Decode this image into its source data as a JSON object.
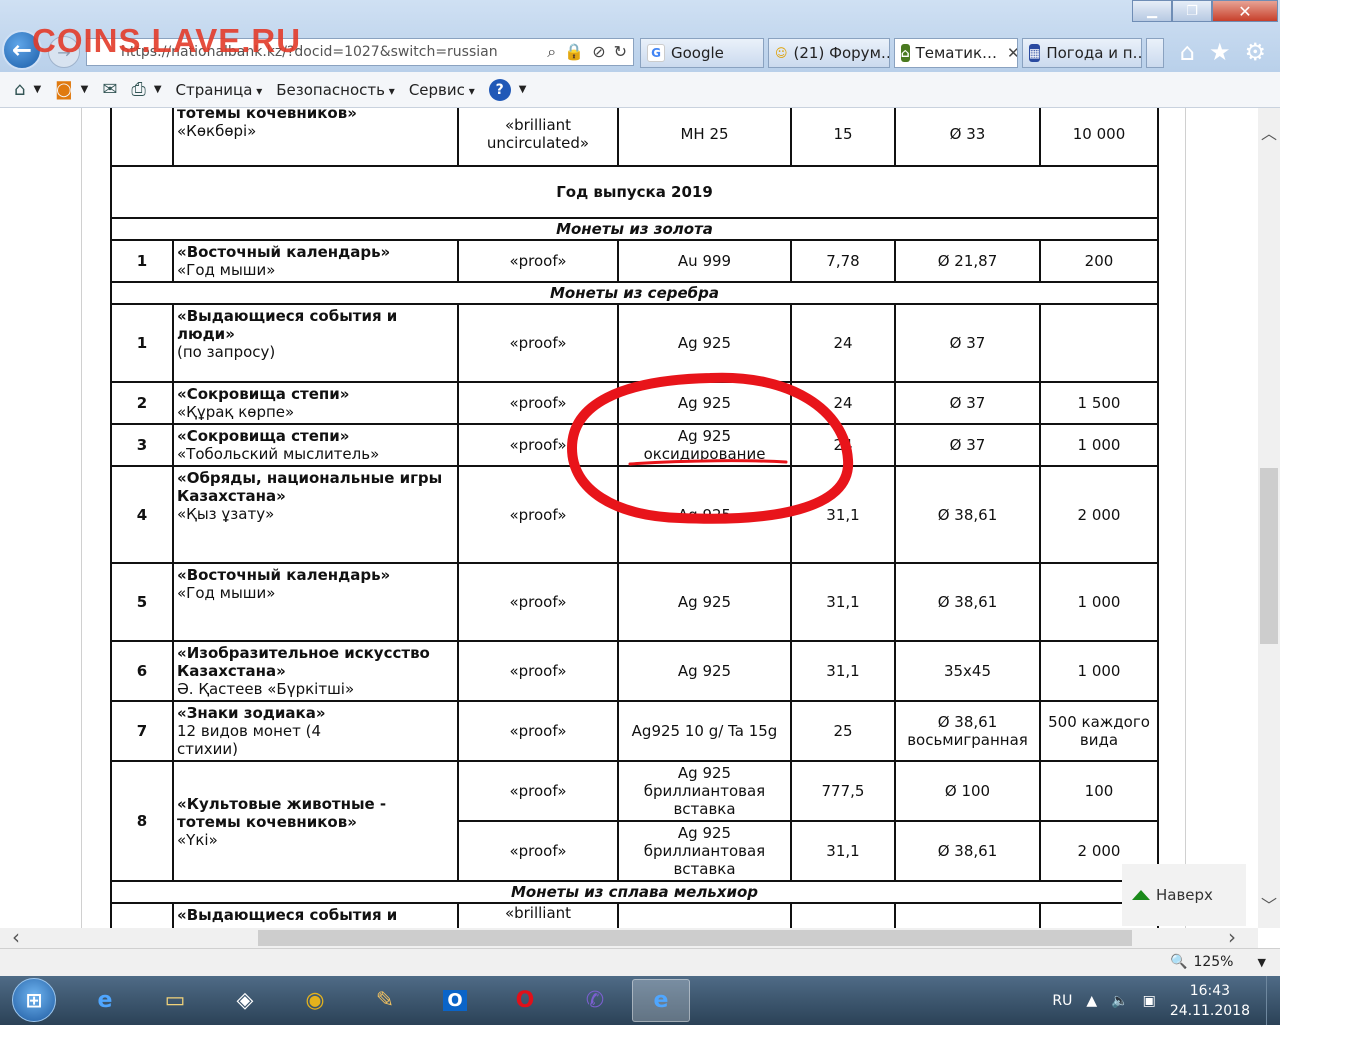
{
  "watermark": "COINS.LAVE.RU",
  "browser": {
    "address": "https://nationalbank.kz/?docid=1027&switch=russian",
    "tabs": [
      {
        "label": "Google",
        "icon": "G",
        "color": "#4285f4"
      },
      {
        "label": "(21) Форум…",
        "icon": "☺",
        "color": "#e0a000"
      },
      {
        "label": "Тематик…",
        "icon": "⌂",
        "color": "#4a7a20"
      },
      {
        "label": "Погода и п…",
        "icon": "▦",
        "color": "#2a4aa0"
      }
    ],
    "tab_close": "✕",
    "window_buttons": {
      "minimize": "▁",
      "maximize": "❐",
      "close": "✕"
    },
    "right_icons": {
      "home": "⌂",
      "favorites": "★",
      "settings": "⚙"
    }
  },
  "commandbar": {
    "menus": [
      "Страница",
      "Безопасность",
      "Сервис"
    ],
    "help": "?"
  },
  "table": {
    "top_row": {
      "name_bold": "тотемы кочевников»",
      "name": "«Көкбөрі»",
      "quality": "«brilliant uncirculated»",
      "metal": "МН 25",
      "weight": "15",
      "diameter": "Ø 33",
      "mintage": "10 000"
    },
    "year_header": "Год выпуска 2019",
    "section_gold": "Монеты из золота",
    "gold_rows": [
      {
        "num": "1",
        "name_bold": "«Восточный календарь»",
        "name": "«Год мыши»",
        "quality": "«proof»",
        "metal": "Au 999",
        "weight": "7,78",
        "diameter": "Ø 21,87",
        "mintage": "200"
      }
    ],
    "section_silver": "Монеты из серебра",
    "silver_rows": [
      {
        "num": "1",
        "name_bold": "«Выдающиеся события и люди»",
        "name": "(по запросу)",
        "quality": "«proof»",
        "metal": "Ag 925",
        "weight": "24",
        "diameter": "Ø 37",
        "mintage": ""
      },
      {
        "num": "2",
        "name_bold": "«Сокровища степи»",
        "name": "«Құрақ көрпе»",
        "quality": "«proof»",
        "metal": "Ag 925",
        "weight": "24",
        "diameter": "Ø 37",
        "mintage": "1 500"
      },
      {
        "num": "3",
        "name_bold": "«Сокровища степи»",
        "name": "«Тобольский мыслитель»",
        "quality": "«proof»",
        "metal": "Ag 925 оксидирование",
        "weight": "24",
        "diameter": "Ø 37",
        "mintage": "1 000"
      },
      {
        "num": "4",
        "name_bold": "«Обряды, национальные игры Казахстана»",
        "name": "«Қыз ұзату»",
        "quality": "«proof»",
        "metal": "Ag 925",
        "weight": "31,1",
        "diameter": "Ø 38,61",
        "mintage": "2 000"
      },
      {
        "num": "5",
        "name_bold": "«Восточный календарь»",
        "name": "«Год мыши»",
        "quality": "«proof»",
        "metal": "Ag 925",
        "weight": "31,1",
        "diameter": "Ø 38,61",
        "mintage": "1 000"
      },
      {
        "num": "6",
        "name_bold": "«Изобразительное искусство Казахстана»",
        "name": "Ә. Қастеев «Бүркітші»",
        "quality": "«proof»",
        "metal": "Ag 925",
        "weight": "31,1",
        "diameter": "35x45",
        "mintage": "1 000"
      },
      {
        "num": "7",
        "name_bold": "«Знаки зодиака»",
        "name": "12 видов монет (4 стихии)",
        "quality": "«proof»",
        "metal": "Ag925 10 g/ Ta 15g",
        "weight": "25",
        "diameter": "Ø 38,61 восьмигранная",
        "mintage": "500 каждого вида"
      }
    ],
    "row8": {
      "num": "8",
      "name_bold": "«Культовые животные - тотемы кочевников»",
      "name": "«Үкі»",
      "a": {
        "quality": "«proof»",
        "metal": "Ag 925 бриллиантовая вставка",
        "weight": "777,5",
        "diameter": "Ø 100",
        "mintage": "100"
      },
      "b": {
        "quality": "«proof»",
        "metal": "Ag 925 бриллиантовая вставка",
        "weight": "31,1",
        "diameter": "Ø 38,61",
        "mintage": "2 000"
      }
    },
    "section_cupronickel": "Монеты из сплава мельхиор",
    "last_row": {
      "name_bold": "«Выдающиеся события и",
      "quality": "«brilliant"
    }
  },
  "back_to_top": "Наверх",
  "statusbar": {
    "zoom": "125%"
  },
  "taskbar": {
    "lang": "RU",
    "time": "16:43",
    "date": "24.11.2018"
  },
  "colors": {
    "annotation": "#e8141a",
    "link_green": "#1a8a1a"
  }
}
